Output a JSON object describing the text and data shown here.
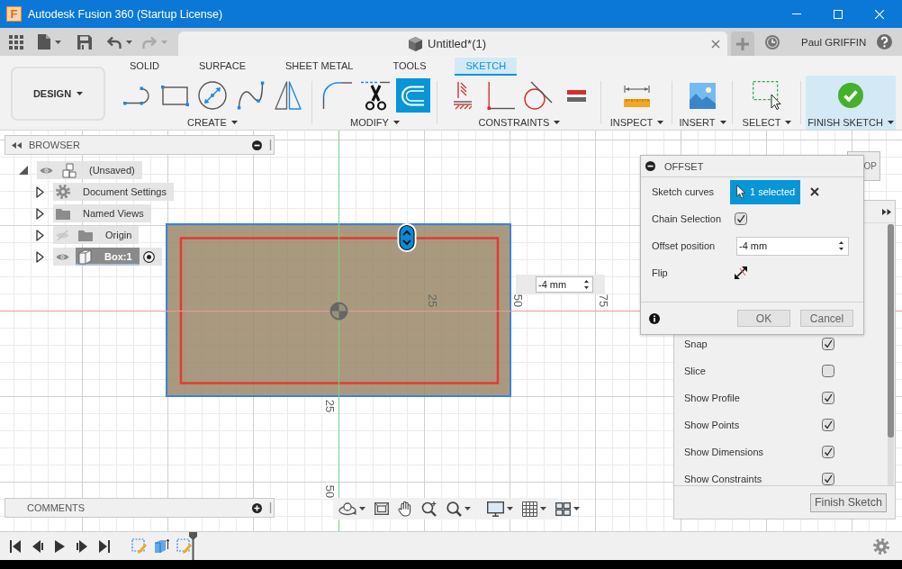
{
  "window": {
    "logo": "F",
    "title": "Autodesk Fusion 360 (Startup License)"
  },
  "quick_access": [
    {
      "kind": "apps",
      "disabled": false
    },
    {
      "kind": "file",
      "disabled": false
    },
    {
      "kind": "save",
      "disabled": false
    },
    {
      "kind": "undo",
      "disabled": false
    },
    {
      "kind": "redo",
      "disabled": true
    }
  ],
  "document_tab": {
    "title": "Untitled*(1)"
  },
  "user": {
    "name": "Paul GRIFFIN"
  },
  "workspace": {
    "label": "DESIGN"
  },
  "toolbar_tabs": [
    {
      "label": "SOLID",
      "selected": false
    },
    {
      "label": "SURFACE",
      "selected": false
    },
    {
      "label": "SHEET METAL",
      "selected": false
    },
    {
      "label": "TOOLS",
      "selected": false
    },
    {
      "label": "SKETCH",
      "selected": true
    }
  ],
  "tool_groups": [
    {
      "label": "CREATE",
      "kind": "tools",
      "tools": [
        {
          "kind": "line",
          "selected": false
        },
        {
          "kind": "rectangle",
          "selected": false
        },
        {
          "kind": "circle",
          "selected": false
        },
        {
          "kind": "spline",
          "selected": false
        },
        {
          "kind": "mirror",
          "selected": false
        }
      ]
    },
    {
      "label": "MODIFY",
      "kind": "tools",
      "tools": [
        {
          "kind": "fillet",
          "selected": false
        },
        {
          "kind": "trim",
          "selected": false
        },
        {
          "kind": "offset",
          "selected": true
        }
      ]
    },
    {
      "label": "CONSTRAINTS",
      "kind": "tools",
      "tools": [
        {
          "kind": "fix",
          "selected": false
        },
        {
          "kind": "perpendicular",
          "selected": false
        },
        {
          "kind": "tangent",
          "selected": false
        },
        {
          "kind": "equal",
          "selected": false
        }
      ]
    },
    {
      "label": "INSPECT",
      "kind": "tools",
      "tools": [
        {
          "kind": "measure",
          "selected": false
        }
      ]
    },
    {
      "label": "INSERT",
      "kind": "tools",
      "tools": [
        {
          "kind": "image",
          "selected": false
        }
      ]
    },
    {
      "label": "SELECT",
      "kind": "tools",
      "tools": [
        {
          "kind": "select",
          "selected": false
        }
      ]
    },
    {
      "label": "FINISH SKETCH",
      "kind": "finish",
      "tools": [
        {
          "kind": "finish",
          "selected": false
        }
      ]
    }
  ],
  "browser": {
    "title": "BROWSER",
    "items": [
      {
        "kind": "document",
        "label": "(Unsaved)",
        "visible": true,
        "expanded": true,
        "selected": false,
        "children": [
          {
            "kind": "settings",
            "label": "Document Settings",
            "expanded": false,
            "selected": false
          },
          {
            "kind": "folder",
            "label": "Named Views",
            "expanded": false,
            "selected": false
          },
          {
            "kind": "folder",
            "label": "Origin",
            "visible": false,
            "expanded": false,
            "selected": false
          },
          {
            "kind": "component",
            "label": "Box:1",
            "visible": true,
            "expanded": false,
            "selected": true,
            "active": true
          }
        ]
      }
    ]
  },
  "canvas": {
    "x_ticks": [
      "25",
      "50",
      "75"
    ],
    "y_ticks": [
      "25",
      "50"
    ],
    "dimension_input": {
      "value": "-4 mm"
    }
  },
  "view_cube": {
    "label": "OP"
  },
  "sketch_palette": {
    "options": [
      {
        "label": "Snap",
        "checked": true
      },
      {
        "label": "Slice",
        "checked": false
      },
      {
        "label": "Show Profile",
        "checked": true
      },
      {
        "label": "Show Points",
        "checked": true
      },
      {
        "label": "Show Dimensions",
        "checked": true
      },
      {
        "label": "Show Constraints",
        "checked": true
      }
    ],
    "button": "Finish Sketch"
  },
  "offset_dialog": {
    "title": "OFFSET",
    "rows": [
      {
        "kind": "selection",
        "label": "Sketch curves",
        "value": "1 selected"
      },
      {
        "kind": "checkbox",
        "label": "Chain Selection",
        "checked": true
      },
      {
        "kind": "number",
        "label": "Offset position",
        "value": "-4 mm"
      },
      {
        "kind": "flip",
        "label": "Flip"
      }
    ],
    "buttons": [
      "OK",
      "Cancel"
    ]
  },
  "comments": {
    "title": "COMMENTS"
  }
}
